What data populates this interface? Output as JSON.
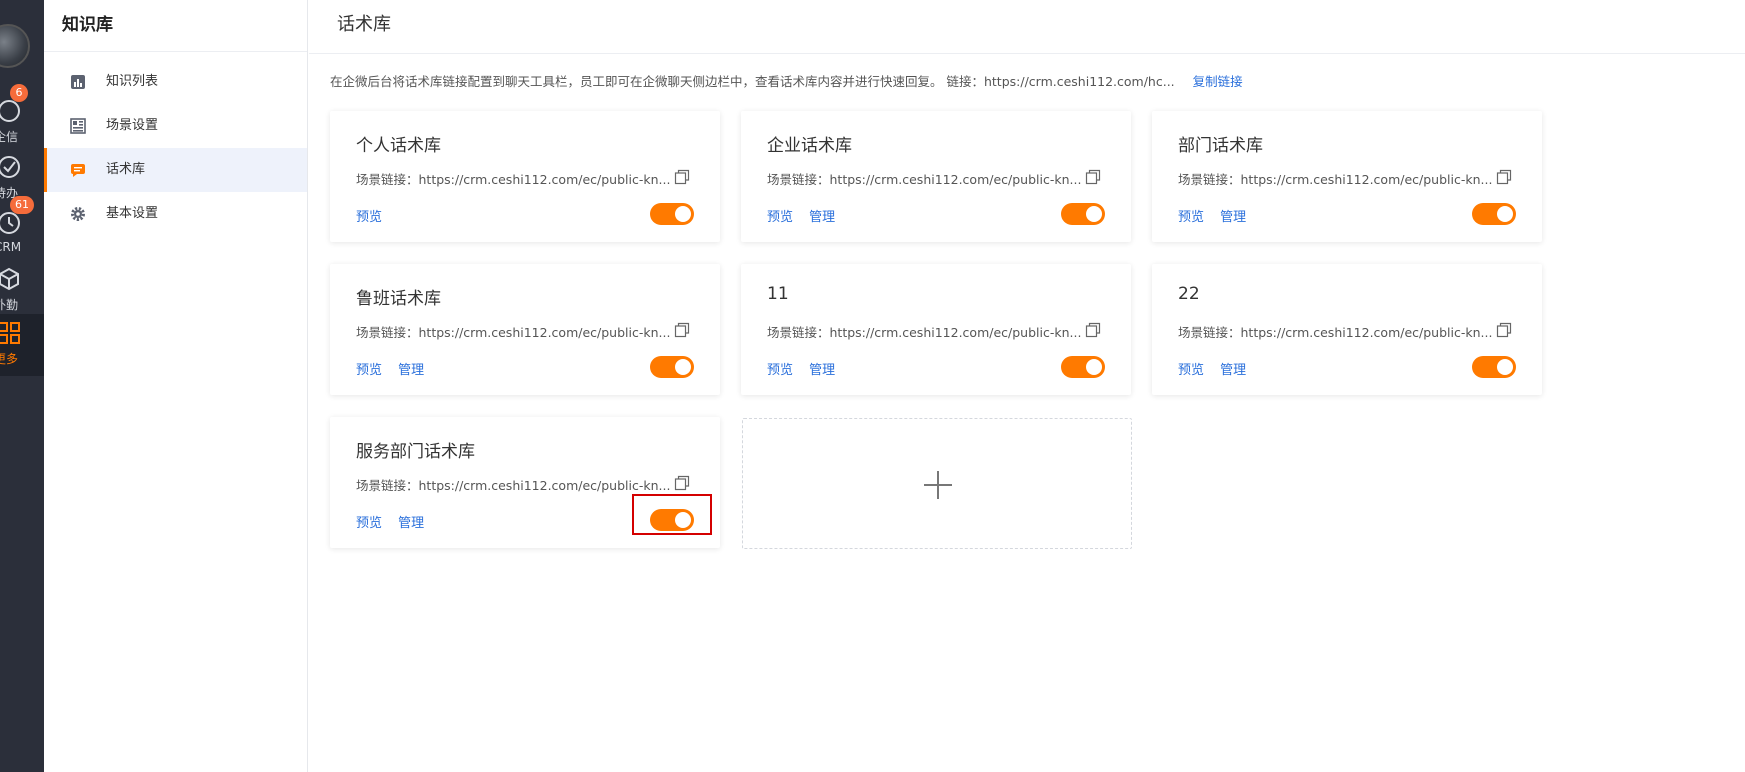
{
  "rail": {
    "items": [
      {
        "label": "企信",
        "badge": "6",
        "icon": "chat-icon"
      },
      {
        "label": "待办",
        "badge": "",
        "icon": "check-circle-icon"
      },
      {
        "label": "CRM",
        "badge": "61",
        "icon": "clock-icon"
      },
      {
        "label": "外勤",
        "badge": "",
        "icon": "cube-icon"
      },
      {
        "label": "更多",
        "badge": "",
        "icon": "grid-icon"
      }
    ]
  },
  "sidebar": {
    "title": "知识库",
    "items": [
      {
        "label": "知识列表",
        "icon": "bar-chart-icon"
      },
      {
        "label": "场景设置",
        "icon": "layout-icon"
      },
      {
        "label": "话术库",
        "icon": "message-icon"
      },
      {
        "label": "基本设置",
        "icon": "gear-icon"
      }
    ]
  },
  "main": {
    "title": "话术库",
    "notice": "在企微后台将话术库链接配置到聊天工具栏，员工即可在企微聊天侧边栏中，查看话术库内容并进行快速回复。 链接：https://crm.ceshi112.com/hc...",
    "copy_link": "复制链接"
  },
  "cards": [
    {
      "title": "个人话术库",
      "link": "场景链接：https://crm.ceshi112.com/ec/public-kn...",
      "preview": "预览",
      "manage": "",
      "enabled": true
    },
    {
      "title": "企业话术库",
      "link": "场景链接：https://crm.ceshi112.com/ec/public-kn...",
      "preview": "预览",
      "manage": "管理",
      "enabled": true
    },
    {
      "title": "部门话术库",
      "link": "场景链接：https://crm.ceshi112.com/ec/public-kn...",
      "preview": "预览",
      "manage": "管理",
      "enabled": true
    },
    {
      "title": "鲁班话术库",
      "link": "场景链接：https://crm.ceshi112.com/ec/public-kn...",
      "preview": "预览",
      "manage": "管理",
      "enabled": true
    },
    {
      "title": "11",
      "link": "场景链接：https://crm.ceshi112.com/ec/public-kn...",
      "preview": "预览",
      "manage": "管理",
      "enabled": true
    },
    {
      "title": "22",
      "link": "场景链接：https://crm.ceshi112.com/ec/public-kn...",
      "preview": "预览",
      "manage": "管理",
      "enabled": true
    },
    {
      "title": "服务部门话术库",
      "link": "场景链接：https://crm.ceshi112.com/ec/public-kn...",
      "preview": "预览",
      "manage": "管理",
      "enabled": true
    }
  ],
  "colors": {
    "accent": "#ff7a00",
    "link": "#2a6fdb",
    "rail_bg": "#2b2f3a",
    "highlight": "#d40000"
  }
}
